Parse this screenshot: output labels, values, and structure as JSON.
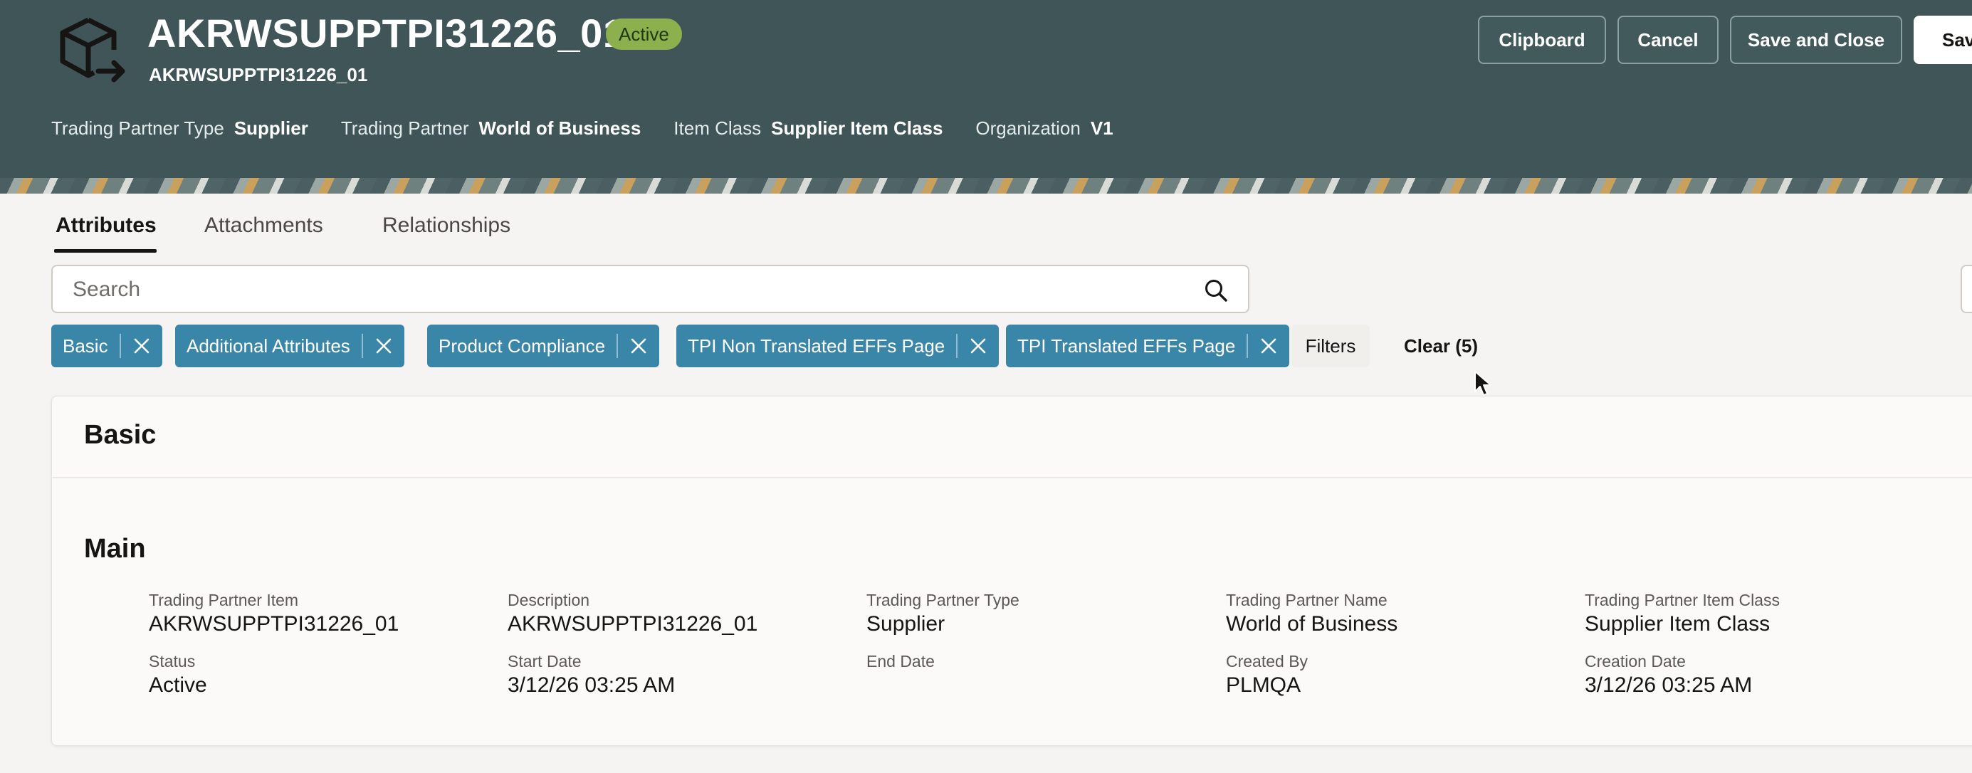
{
  "header": {
    "title": "AKRWSUPPTPI31226_01",
    "status": "Active",
    "subtitle": "AKRWSUPPTPI31226_01",
    "meta": [
      {
        "label": "Trading Partner Type",
        "value": "Supplier"
      },
      {
        "label": "Trading Partner",
        "value": "World of Business"
      },
      {
        "label": "Item Class",
        "value": "Supplier Item Class"
      },
      {
        "label": "Organization",
        "value": "V1"
      }
    ],
    "buttons": {
      "clipboard": "Clipboard",
      "cancel": "Cancel",
      "save_close": "Save and Close",
      "save": "Sav"
    }
  },
  "tabs": [
    {
      "label": "Attributes",
      "active": true
    },
    {
      "label": "Attachments",
      "active": false
    },
    {
      "label": "Relationships",
      "active": false
    }
  ],
  "search": {
    "placeholder": "Search",
    "value": ""
  },
  "chips": [
    {
      "label": "Basic"
    },
    {
      "label": "Additional Attributes"
    },
    {
      "label": "Product Compliance"
    },
    {
      "label": "TPI Non Translated EFFs Page"
    },
    {
      "label": "TPI Translated EFFs Page"
    }
  ],
  "filters_label": "Filters",
  "clear_label": "Clear (5)",
  "sections": {
    "basic_title": "Basic",
    "main_title": "Main"
  },
  "fields": [
    {
      "label": "Trading Partner Item",
      "value": "AKRWSUPPTPI31226_01"
    },
    {
      "label": "Description",
      "value": "AKRWSUPPTPI31226_01"
    },
    {
      "label": "Trading Partner Type",
      "value": "Supplier"
    },
    {
      "label": "Trading Partner Name",
      "value": "World of Business"
    },
    {
      "label": "Trading Partner Item Class",
      "value": "Supplier Item Class"
    },
    {
      "label": "Status",
      "value": "Active"
    },
    {
      "label": "Start Date",
      "value": "3/12/26 03:25 AM"
    },
    {
      "label": "End Date",
      "value": ""
    },
    {
      "label": "Created By",
      "value": "PLMQA"
    },
    {
      "label": "Creation Date",
      "value": "3/12/26 03:25 AM"
    }
  ],
  "colors": {
    "header_bg": "#3f5557",
    "chip_bg": "#3a86a8",
    "status_pill": "#8db04f"
  },
  "icons": {
    "entity": "cube-arrow-icon",
    "search": "search-icon",
    "chip_remove": "close-icon",
    "pointer": "mouse-cursor-icon"
  }
}
